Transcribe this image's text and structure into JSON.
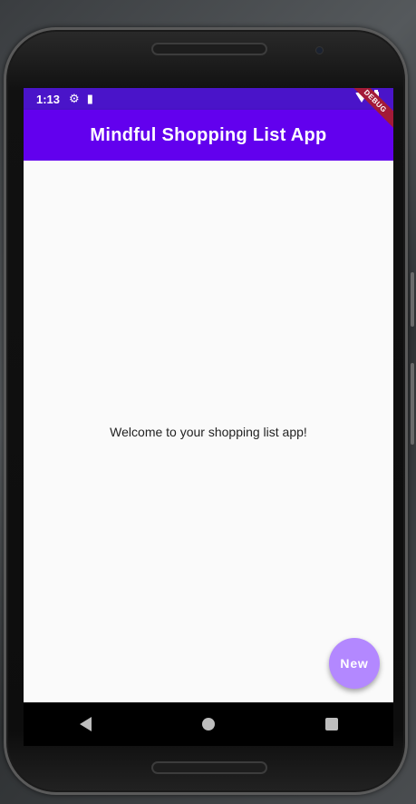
{
  "status_bar": {
    "time": "1:13",
    "settings_icon": "gear-icon",
    "sd_icon": "sd-card-icon",
    "wifi_icon": "wifi-icon",
    "battery_icon": "battery-icon"
  },
  "debug_banner": "DEBUG",
  "app_bar": {
    "title": "Mindful Shopping List App",
    "color": "#6200ee"
  },
  "body": {
    "welcome_text": "Welcome to your shopping list app!"
  },
  "fab": {
    "label": "New",
    "color": "#b388ff"
  },
  "nav_bar": {
    "back_icon": "back-triangle-icon",
    "home_icon": "home-circle-icon",
    "recents_icon": "recents-square-icon"
  }
}
